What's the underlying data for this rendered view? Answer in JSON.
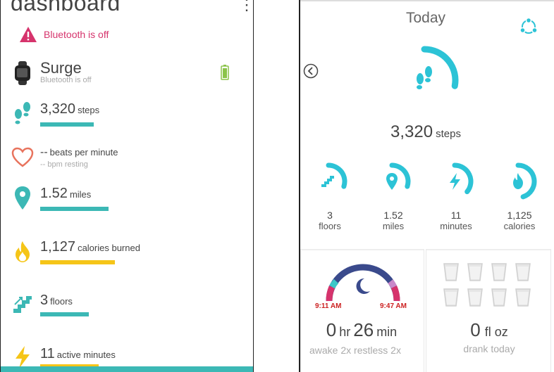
{
  "left": {
    "title": "dashboard",
    "bluetooth_warning": "Bluetooth is off",
    "device": {
      "name": "Surge",
      "status": "Bluetooth is off"
    },
    "steps": {
      "value": "3,320",
      "unit": "steps",
      "progress": 0.33
    },
    "heart": {
      "value": "--",
      "unit": "beats per minute",
      "resting": "-- bpm resting"
    },
    "distance": {
      "value": "1.52",
      "unit": "miles",
      "progress": 0.42
    },
    "calories": {
      "value": "1,127",
      "unit": "calories burned",
      "progress": 0.46
    },
    "floors": {
      "value": "3",
      "unit": "floors",
      "progress": 0.3
    },
    "active": {
      "value": "11",
      "unit": "active minutes",
      "progress": 0.36
    }
  },
  "right": {
    "title": "Today",
    "steps": {
      "value": "3,320",
      "unit": "steps",
      "progress": 0.28
    },
    "stats": [
      {
        "value": "3",
        "label": "floors",
        "icon": "stairs-icon",
        "progress": 0.3
      },
      {
        "value": "1.52",
        "label": "miles",
        "icon": "location-pin-icon",
        "progress": 0.3
      },
      {
        "value": "11",
        "label": "minutes",
        "icon": "lightning-icon",
        "progress": 0.36
      },
      {
        "value": "1,125",
        "label": "calories",
        "icon": "flame-icon",
        "progress": 0.45
      }
    ],
    "sleep": {
      "start": "9:11 AM",
      "end": "9:47 AM",
      "hours": "0",
      "hours_unit": "hr",
      "minutes": "26",
      "minutes_unit": "min",
      "summary": "awake 2x restless 2x"
    },
    "water": {
      "value": "0",
      "unit": "fl oz",
      "summary": "drank today"
    }
  },
  "colors": {
    "teal": "#3cb8b5",
    "ring": "#2cc3d6",
    "yellow": "#f5c518",
    "pink": "#d6336c",
    "heart": "#e8735d",
    "sleep_dark": "#3a4a8c"
  }
}
